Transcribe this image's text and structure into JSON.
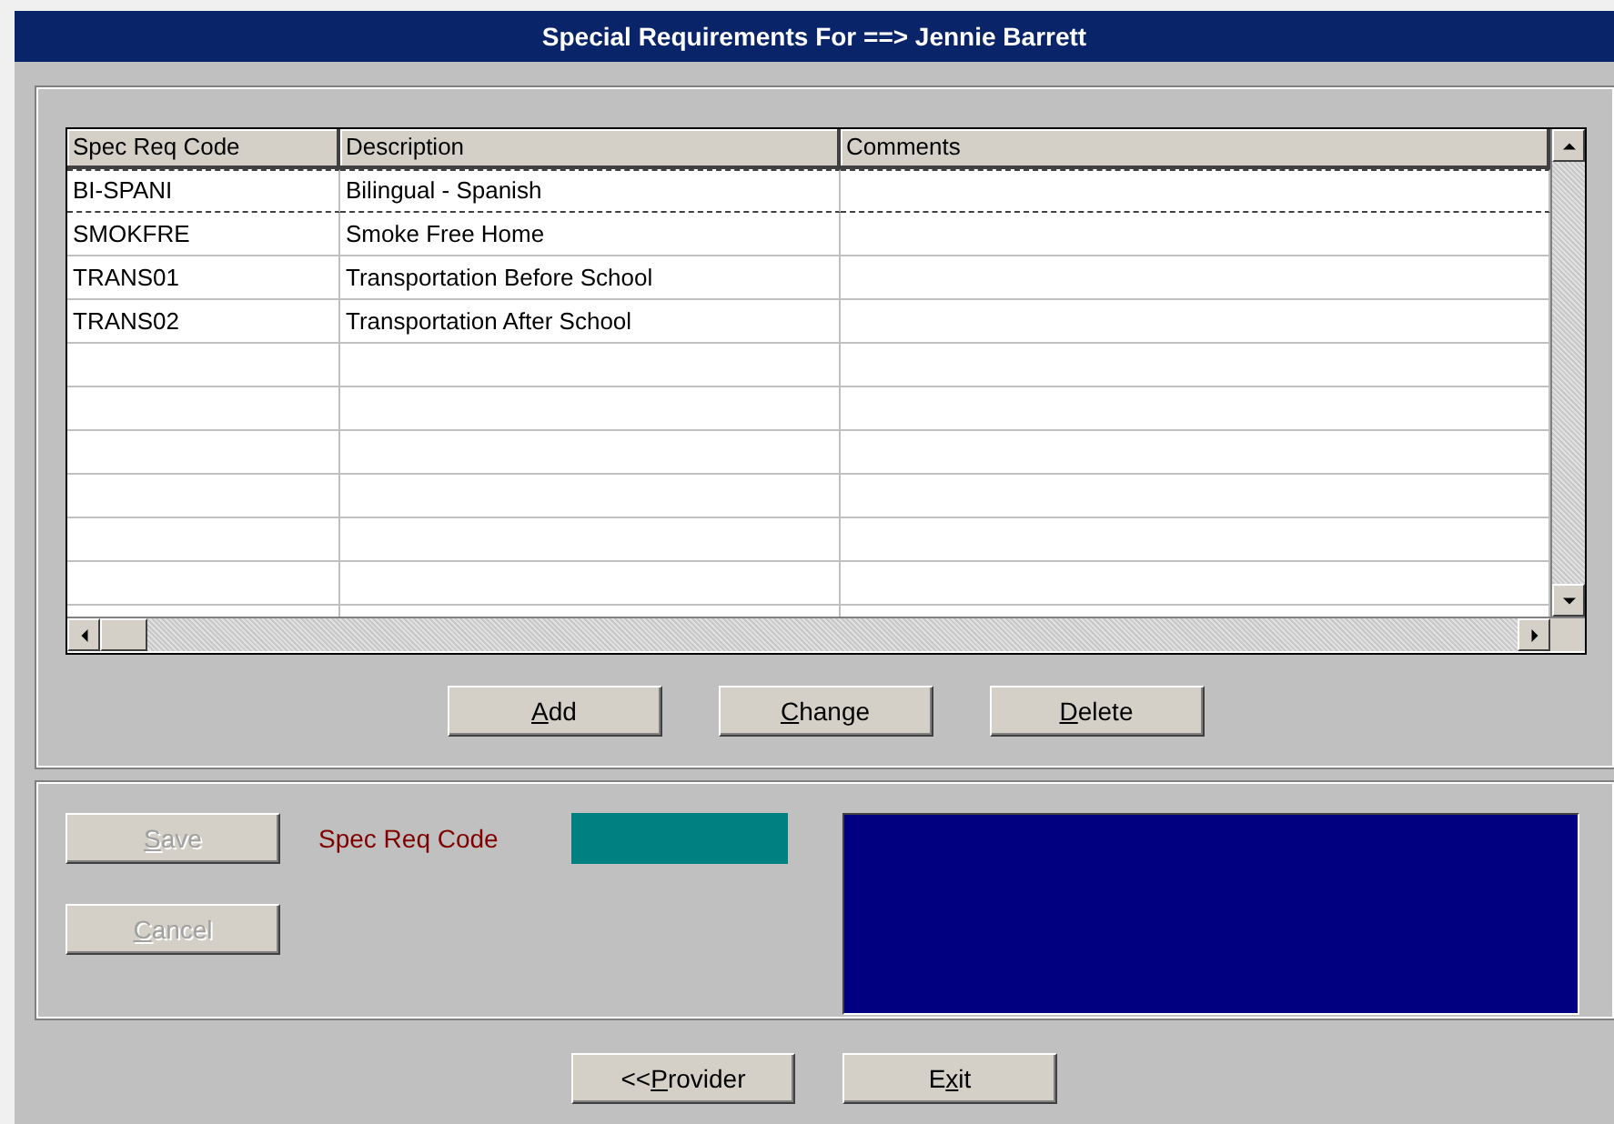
{
  "window": {
    "title": "Special Requirements For ==> Jennie Barrett"
  },
  "table": {
    "columns": [
      "Spec Req Code",
      "Description",
      "Comments"
    ],
    "rows": [
      {
        "cells": [
          "BI-SPANI",
          "Bilingual - Spanish"
        ],
        "selected": true
      },
      {
        "cells": [
          "SMOKFRE",
          "Smoke Free Home"
        ],
        "selected": false
      },
      {
        "cells": [
          "TRANS01",
          "Transportation Before School"
        ],
        "selected": false
      },
      {
        "cells": [
          "TRANS02",
          "Transportation After School"
        ],
        "selected": false
      }
    ]
  },
  "list_buttons": [
    {
      "key": "A",
      "after": "dd",
      "disabled": false
    },
    {
      "key": "C",
      "after": "hange",
      "disabled": false
    },
    {
      "key": "D",
      "after": "elete",
      "disabled": false
    }
  ],
  "edit_buttons": [
    {
      "key": "S",
      "after": "ave",
      "disabled": true
    },
    {
      "key": "C",
      "after": "ancel",
      "disabled": true
    }
  ],
  "field": {
    "label": "Spec Req Code"
  },
  "footer_buttons": [
    {
      "before": "<<",
      "key": "P",
      "after": "rovider",
      "disabled": false
    },
    {
      "before": "E",
      "key": "x",
      "after": "it",
      "disabled": false
    }
  ]
}
